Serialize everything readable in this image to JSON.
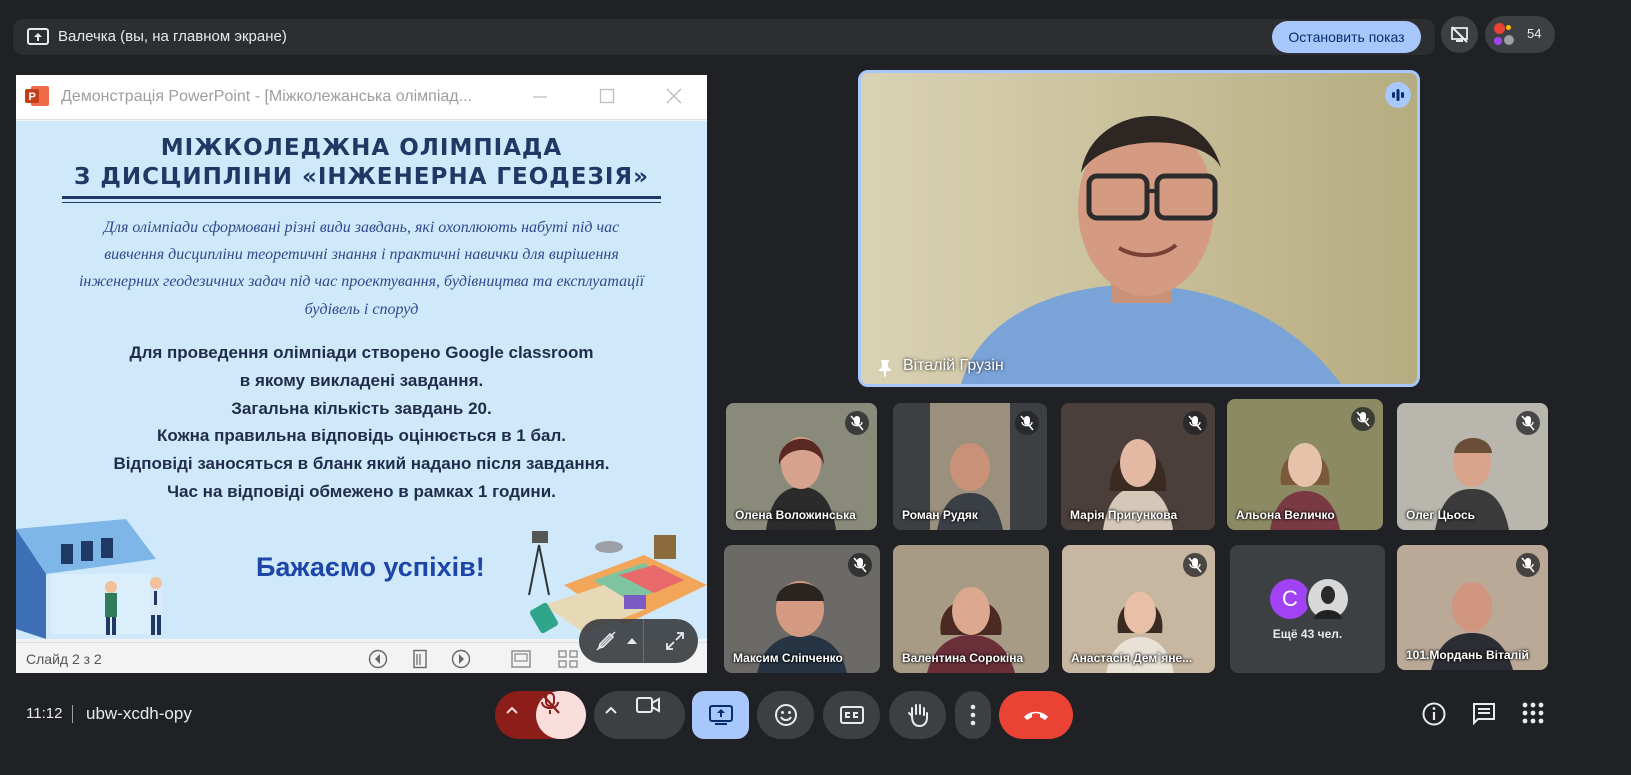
{
  "presenting_bar": {
    "text": "Валечка (вы, на главном экране)",
    "stop_label": "Остановить показ",
    "participants_count": "54"
  },
  "ppt_window": {
    "title": "Демонстрація PowerPoint - [Міжколежанська олімпіад...",
    "status": "Слайд 2 з 2"
  },
  "slide": {
    "title_line1": "МІЖКОЛЕДЖНА ОЛІМПІАДА",
    "title_line2": "З ДИСЦИПЛІНИ «ІНЖЕНЕРНА ГЕОДЕЗІЯ»",
    "italic_lines": [
      "Для олімпіади сформовані різні види завдань, які охоплюють набуті під час",
      "вивчення дисципліни теоретичні знання і практичні навички для вирішення",
      "інженерних геодезичних задач під час проектування, будівництва та експлуатації",
      "будівель і споруд"
    ],
    "body_lines": [
      "Для проведення олімпіади створено Google classroom",
      "в якому викладені завдання.",
      "Загальна кількість завдань 20.",
      "Кожна правильна відповідь оцінюється в 1 бал.",
      "Відповіді заносяться в бланк який надано після завдання.",
      "Час на відповіді обмежено в рамках 1 години."
    ],
    "wish": "Бажаємо успіхів!"
  },
  "speaker": {
    "name": "Віталій Грузін"
  },
  "tiles": [
    {
      "name": "Олена Воложинська",
      "bg": "#8a8a7a"
    },
    {
      "name": "Роман Рудяк",
      "bg": "#9b8f7e"
    },
    {
      "name": "Марія Пригункова",
      "bg": "#4a3f3a"
    },
    {
      "name": "Альона Величко",
      "bg": "#8c8a63"
    },
    {
      "name": "Олег Цьось",
      "bg": "#b9b7ad"
    },
    {
      "name": "Максим Сліпченко",
      "bg": "#6c6a66"
    },
    {
      "name": "Валентина Сорокіна",
      "bg": "#a89b86"
    },
    {
      "name": "Анастасія Дем`яне...",
      "bg": "#c7b6a0"
    },
    {
      "name": "Ещё 43 чел.",
      "avatar_letter": "С",
      "avatar_color": "#a142f4"
    },
    {
      "name": "101.Мордань Віталій",
      "bg": "#b9a996"
    }
  ],
  "bottom_bar": {
    "time": "11:12",
    "meeting_code": "ubw-xcdh-opy"
  },
  "colors": {
    "accent": "#a8c7fa",
    "end_call": "#ea4335",
    "mic_off_bg": "#f9dedc",
    "mic_off_group": "#8c1d18"
  }
}
